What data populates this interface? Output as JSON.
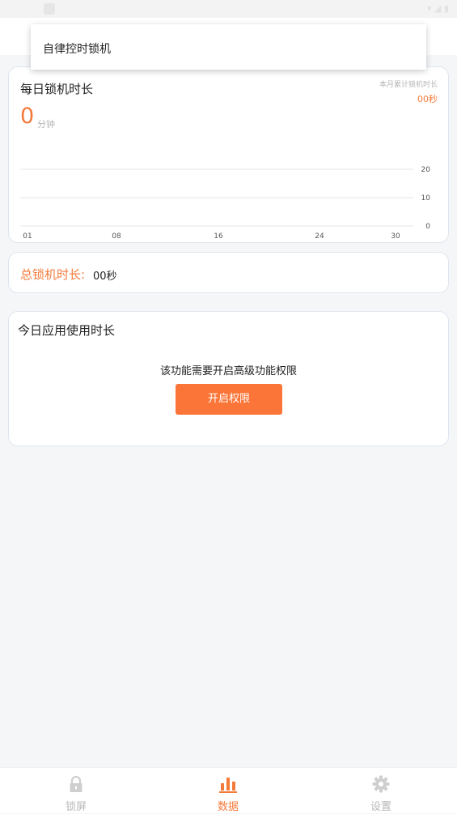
{
  "popup": {
    "item_label": "自律控时锁机"
  },
  "daily_card": {
    "title": "每日锁机时长",
    "today_value": "0",
    "today_unit": "分钟",
    "month_label": "本月累计锁机时长",
    "month_value": "00秒"
  },
  "chart_data": {
    "type": "bar",
    "x_tick_labels": [
      "01",
      "08",
      "16",
      "24",
      "30"
    ],
    "y_tick_labels": [
      "20",
      "10",
      "0"
    ],
    "ylim": [
      0,
      20
    ],
    "values": []
  },
  "total_card": {
    "label": "总锁机时长:",
    "value": "00秒"
  },
  "app_usage_card": {
    "title": "今日应用使用时长",
    "notice": "该功能需要开启高级功能权限",
    "button_label": "开启权限"
  },
  "tabbar": {
    "tabs": [
      {
        "label": "锁屏",
        "icon": "lock-icon",
        "active": false
      },
      {
        "label": "数据",
        "icon": "bar-chart-icon",
        "active": true
      },
      {
        "label": "设置",
        "icon": "gear-icon",
        "active": false
      }
    ]
  },
  "colors": {
    "accent": "#f47a3a",
    "button": "#fb7538",
    "inactive": "#b8b8b8"
  }
}
